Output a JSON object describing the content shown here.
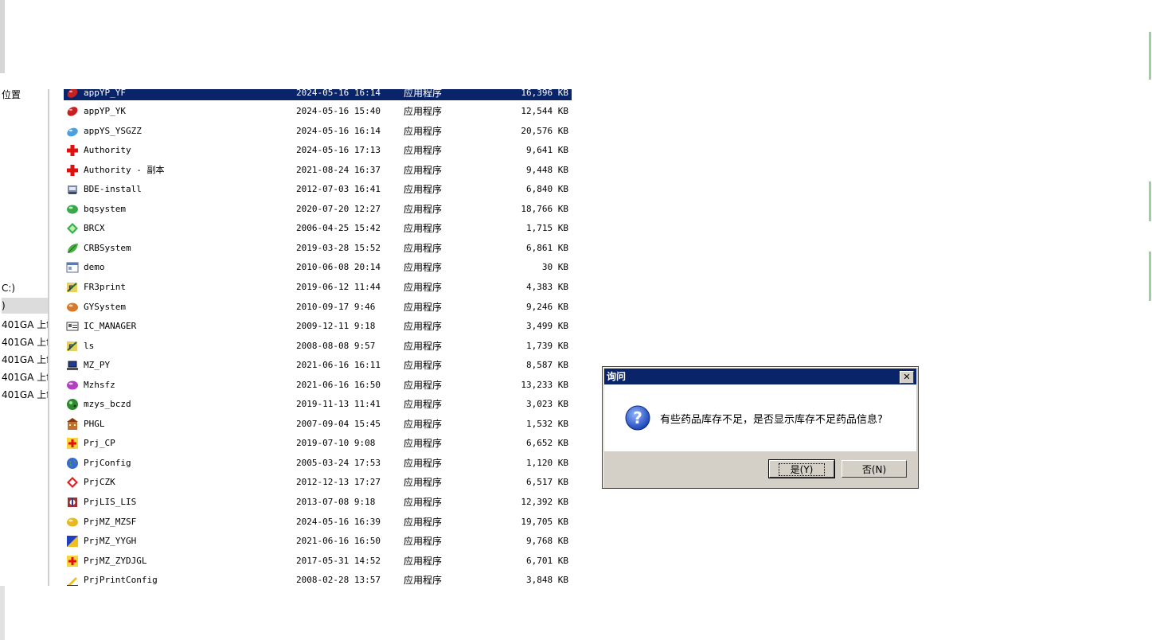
{
  "nav": {
    "items": [
      "位置",
      "C:)",
      ")",
      "401GA 上f",
      "401GA 上f",
      "401GA 上f",
      "401GA 上f",
      "401GA 上f"
    ]
  },
  "files": [
    {
      "name": "appYP_YF",
      "date": "2024-05-16 16:14",
      "type": "应用程序",
      "size": "16,396 KB",
      "icon": "red-capsule-icon"
    },
    {
      "name": "appYP_YK",
      "date": "2024-05-16 15:40",
      "type": "应用程序",
      "size": "12,544 KB",
      "icon": "red-capsule-icon"
    },
    {
      "name": "appYS_YSGZZ",
      "date": "2024-05-16 16:14",
      "type": "应用程序",
      "size": "20,576 KB",
      "icon": "blue-capsule-icon"
    },
    {
      "name": "Authority",
      "date": "2024-05-16 17:13",
      "type": "应用程序",
      "size": "9,641 KB",
      "icon": "red-cross-icon"
    },
    {
      "name": "Authority - 副本",
      "date": "2021-08-24 16:37",
      "type": "应用程序",
      "size": "9,448 KB",
      "icon": "red-cross-icon"
    },
    {
      "name": "BDE-install",
      "date": "2012-07-03 16:41",
      "type": "应用程序",
      "size": "6,840 KB",
      "icon": "installer-icon"
    },
    {
      "name": "bqsystem",
      "date": "2020-07-20 12:27",
      "type": "应用程序",
      "size": "18,766 KB",
      "icon": "green-capsule-icon"
    },
    {
      "name": "BRCX",
      "date": "2006-04-25 15:42",
      "type": "应用程序",
      "size": "1,715 KB",
      "icon": "green-diamond-icon"
    },
    {
      "name": "CRBSystem",
      "date": "2019-03-28 15:52",
      "type": "应用程序",
      "size": "6,861 KB",
      "icon": "leaf-icon"
    },
    {
      "name": "demo",
      "date": "2010-06-08 20:14",
      "type": "应用程序",
      "size": "30 KB",
      "icon": "window-icon"
    },
    {
      "name": "FR3print",
      "date": "2019-06-12 11:44",
      "type": "应用程序",
      "size": "4,383 KB",
      "icon": "fr-icon"
    },
    {
      "name": "GYSystem",
      "date": "2010-09-17 9:46",
      "type": "应用程序",
      "size": "9,246 KB",
      "icon": "orange-capsule-icon"
    },
    {
      "name": "IC_MANAGER",
      "date": "2009-12-11 9:18",
      "type": "应用程序",
      "size": "3,499 KB",
      "icon": "card-icon"
    },
    {
      "name": "ls",
      "date": "2008-08-08 9:57",
      "type": "应用程序",
      "size": "1,739 KB",
      "icon": "fr-icon"
    },
    {
      "name": "MZ_PY",
      "date": "2021-06-16 16:11",
      "type": "应用程序",
      "size": "8,587 KB",
      "icon": "laptop-icon"
    },
    {
      "name": "Mzhsfz",
      "date": "2021-06-16 16:50",
      "type": "应用程序",
      "size": "13,233 KB",
      "icon": "purple-capsule-icon"
    },
    {
      "name": "mzys_bczd",
      "date": "2019-11-13 11:41",
      "type": "应用程序",
      "size": "3,023 KB",
      "icon": "green-sphere-icon"
    },
    {
      "name": "PHGL",
      "date": "2007-09-04 15:45",
      "type": "应用程序",
      "size": "1,532 KB",
      "icon": "building-icon"
    },
    {
      "name": "Prj_CP",
      "date": "2019-07-10 9:08",
      "type": "应用程序",
      "size": "6,652 KB",
      "icon": "yellow-cross-icon"
    },
    {
      "name": "PrjConfig",
      "date": "2005-03-24 17:53",
      "type": "应用程序",
      "size": "1,120 KB",
      "icon": "globe-icon"
    },
    {
      "name": "PrjCZK",
      "date": "2012-12-13 17:27",
      "type": "应用程序",
      "size": "6,517 KB",
      "icon": "red-diamond-icon"
    },
    {
      "name": "PrjLIS_LIS",
      "date": "2013-07-08 9:18",
      "type": "应用程序",
      "size": "12,392 KB",
      "icon": "lab-icon"
    },
    {
      "name": "PrjMZ_MZSF",
      "date": "2024-05-16 16:39",
      "type": "应用程序",
      "size": "19,705 KB",
      "icon": "yellow-capsule-icon"
    },
    {
      "name": "PrjMZ_YYGH",
      "date": "2021-06-16 16:50",
      "type": "应用程序",
      "size": "9,768 KB",
      "icon": "triangle-icon"
    },
    {
      "name": "PrjMZ_ZYDJGL",
      "date": "2017-05-31 14:52",
      "type": "应用程序",
      "size": "6,701 KB",
      "icon": "yellow-cross-icon"
    },
    {
      "name": "PrjPrintConfig",
      "date": "2008-02-28 13:57",
      "type": "应用程序",
      "size": "3,848 KB",
      "icon": "pen-icon"
    }
  ],
  "dialog": {
    "title": "询问",
    "close": "✕",
    "message": "有些药品库存不足，是否显示库存不足药品信息?",
    "yes_label": "是(Y)",
    "no_label": "否(N)"
  },
  "colors": {
    "selection": "#0a246a",
    "dialog_face": "#d4d0c8"
  }
}
